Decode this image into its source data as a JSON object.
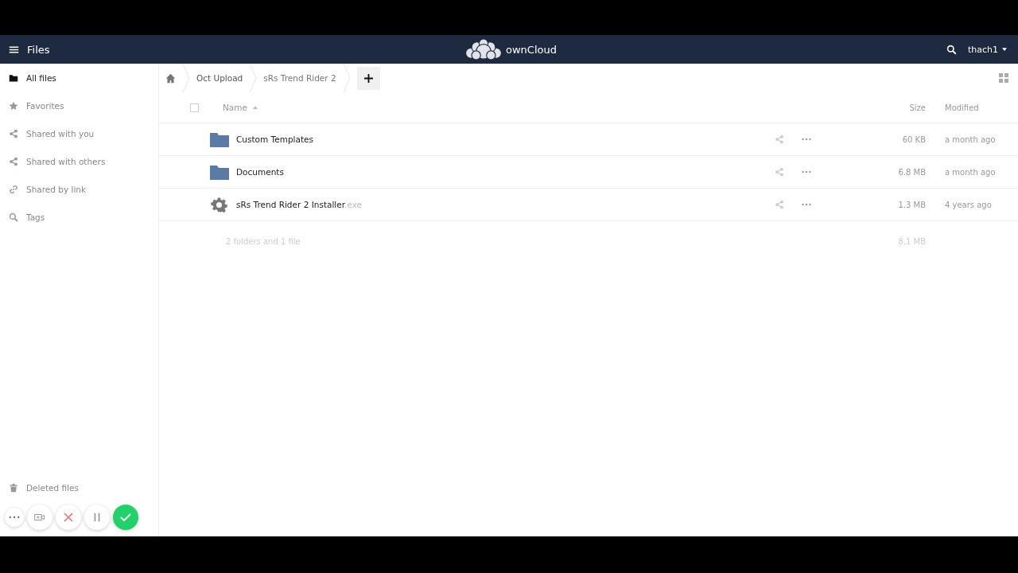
{
  "header": {
    "app_title": "Files",
    "brand": "ownCloud",
    "user": "thach1"
  },
  "sidebar": {
    "items": [
      {
        "label": "All files",
        "kind": "folder",
        "selected": true
      },
      {
        "label": "Favorites",
        "kind": "star",
        "selected": false
      },
      {
        "label": "Shared with you",
        "kind": "share",
        "selected": false
      },
      {
        "label": "Shared with others",
        "kind": "share",
        "selected": false
      },
      {
        "label": "Shared by link",
        "kind": "link",
        "selected": false
      },
      {
        "label": "Tags",
        "kind": "search",
        "selected": false
      }
    ],
    "bottom_items": [
      {
        "label": "Deleted files",
        "kind": "trash"
      }
    ]
  },
  "breadcrumbs": [
    "Oct Upload",
    "sRs Trend Rider 2"
  ],
  "table": {
    "select_all_checked": false,
    "columns": [
      "Name",
      "Size",
      "Modified"
    ],
    "rows": [
      {
        "kind": "folder",
        "name": "Custom Templates",
        "size": "60 KB",
        "modified": "a month ago"
      },
      {
        "kind": "folder",
        "name": "Documents",
        "size": "6.8 MB",
        "modified": "a month ago"
      },
      {
        "kind": "file",
        "name": "sRs Trend Rider 2 Installer",
        "extension": ".exe",
        "size": "1.3 MB",
        "modified": "4 years ago"
      }
    ],
    "summary": {
      "text": "2 folders and 1 file",
      "size": "8.1 MB"
    }
  },
  "recorder": {
    "buttons": [
      {
        "kind": "more"
      },
      {
        "kind": "camera"
      },
      {
        "kind": "cancel"
      },
      {
        "kind": "pause"
      },
      {
        "kind": "done"
      }
    ]
  }
}
